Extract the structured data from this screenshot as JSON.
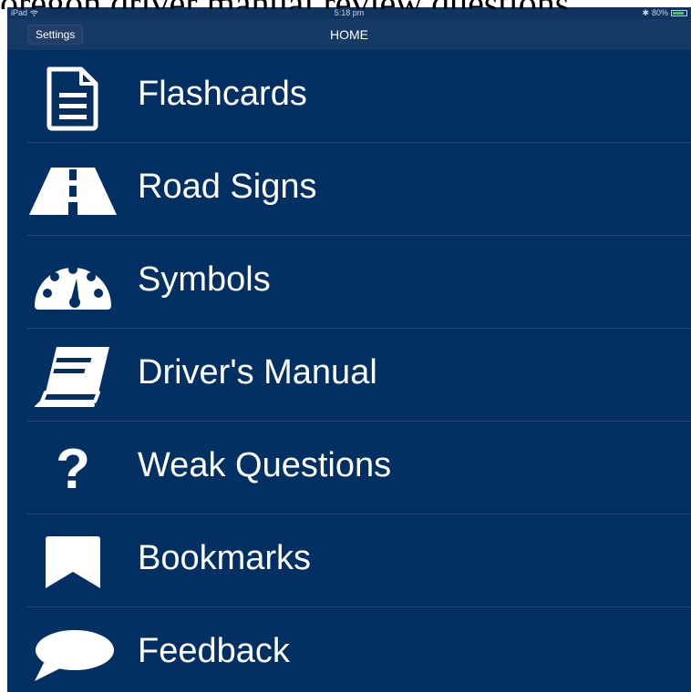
{
  "caption": "oregon driver manual review questions",
  "status_bar": {
    "device": "iPad",
    "time": "5:18 pm",
    "battery": "80%"
  },
  "nav": {
    "settings_label": "Settings",
    "title": "HOME"
  },
  "menu": [
    {
      "label": "Flashcards",
      "icon": "document-icon"
    },
    {
      "label": "Road Signs",
      "icon": "road-icon"
    },
    {
      "label": "Symbols",
      "icon": "gauge-icon"
    },
    {
      "label": "Driver's Manual",
      "icon": "book-icon"
    },
    {
      "label": "Weak Questions",
      "icon": "question-icon"
    },
    {
      "label": "Bookmarks",
      "icon": "bookmark-icon"
    },
    {
      "label": "Feedback",
      "icon": "speech-bubble-icon"
    }
  ],
  "colors": {
    "background": "#023062",
    "navbar": "#153a66",
    "text": "#ffffff"
  }
}
